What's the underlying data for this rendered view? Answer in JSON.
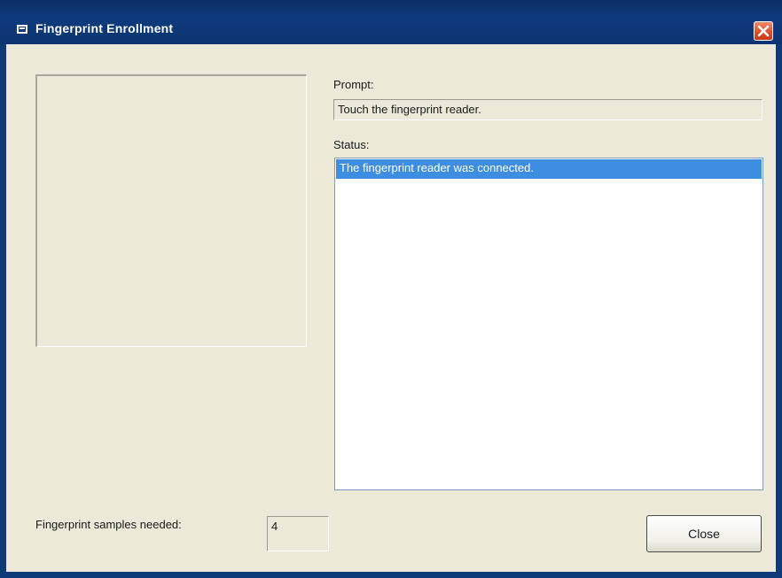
{
  "window": {
    "title": "Fingerprint Enrollment"
  },
  "prompt": {
    "label": "Prompt:",
    "value": "Touch the fingerprint reader."
  },
  "status": {
    "label": "Status:",
    "items": [
      "The fingerprint reader was connected."
    ]
  },
  "samples": {
    "label": "Fingerprint samples needed:",
    "value": "4"
  },
  "buttons": {
    "close_label": "Close"
  },
  "colors": {
    "titlebar": "#0e3a7c",
    "selection": "#3d8ee0",
    "close_x": "#dd4b26",
    "client_bg": "#ece9d8"
  },
  "icons": {
    "title_icon": "app-icon",
    "close_icon": "close-icon"
  }
}
